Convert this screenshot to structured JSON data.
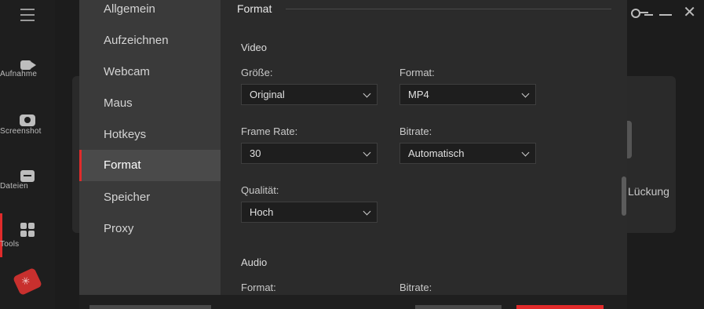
{
  "app": {
    "nav": [
      {
        "label": "Aufnahme",
        "icon": "video-camera-icon"
      },
      {
        "label": "Screenshot",
        "icon": "camera-icon"
      },
      {
        "label": "Dateien",
        "icon": "folder-icon"
      },
      {
        "label": "Tools",
        "icon": "tools-grid-icon"
      }
    ],
    "background_text": "Lückung",
    "accent_color": "#e02b2b"
  },
  "settings": {
    "nav": [
      {
        "label": "Allgemein"
      },
      {
        "label": "Aufzeichnen"
      },
      {
        "label": "Webcam"
      },
      {
        "label": "Maus"
      },
      {
        "label": "Hotkeys"
      },
      {
        "label": "Format",
        "active": true
      },
      {
        "label": "Speicher"
      },
      {
        "label": "Proxy"
      }
    ],
    "section_title": "Format",
    "video": {
      "heading": "Video",
      "size_label": "Größe:",
      "size_value": "Original",
      "format_label": "Format:",
      "format_value": "MP4",
      "framerate_label": "Frame Rate:",
      "framerate_value": "30",
      "bitrate_label": "Bitrate:",
      "bitrate_value": "Automatisch",
      "quality_label": "Qualität:",
      "quality_value": "Hoch"
    },
    "audio": {
      "heading": "Audio",
      "format_label": "Format:",
      "bitrate_label": "Bitrate:"
    }
  }
}
